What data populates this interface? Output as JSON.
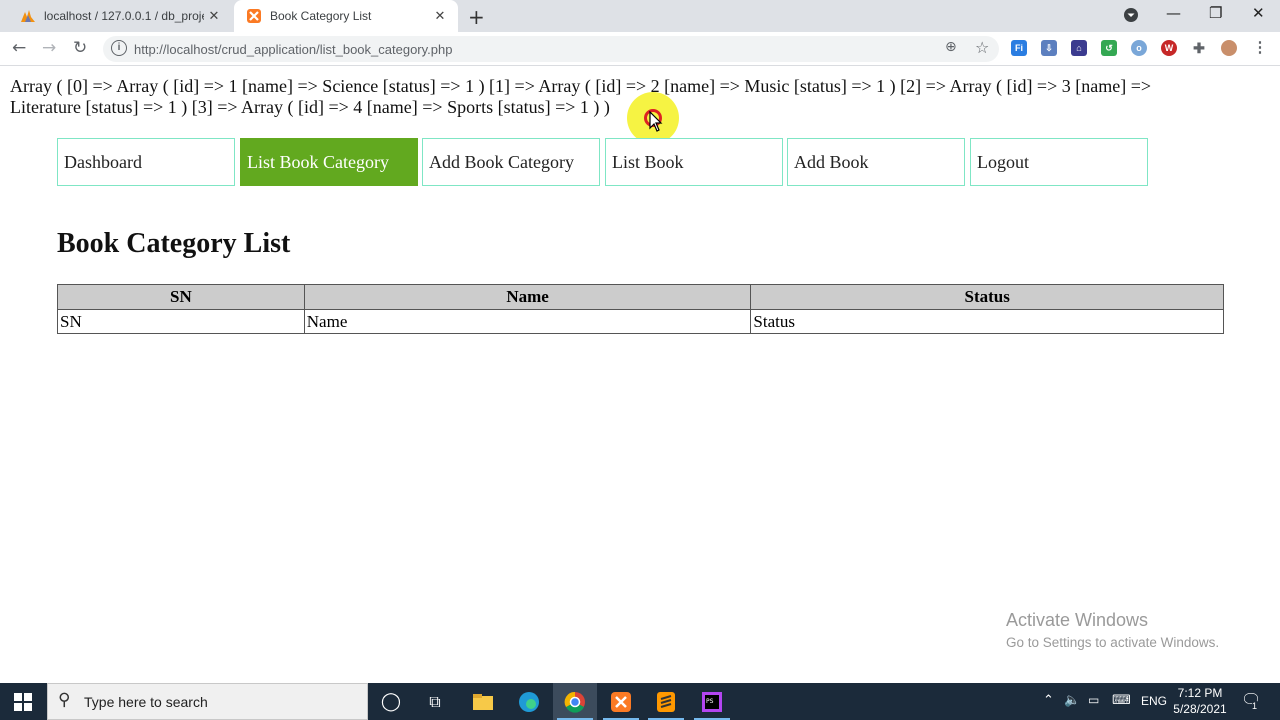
{
  "browser": {
    "tabs": [
      {
        "title": "localhost / 127.0.0.1 / db_project",
        "active": false
      },
      {
        "title": "Book Category List",
        "active": true
      }
    ],
    "url": "http://localhost/crud_application/list_book_category.php"
  },
  "page": {
    "print_r_line1": "Array ( [0] => Array ( [id] => 1 [name] => Science [status] => 1 ) [1] => Array ( [id] => 2 [name] => Music [status] => 1 ) [2] => Array ( [id] => 3 [name] =>",
    "print_r_line2": "Literature [status] => 1 ) [3] => Array ( [id] => 4 [name] => Sports [status] => 1 ) )",
    "menu": [
      {
        "label": "Dashboard",
        "active": false
      },
      {
        "label": "List Book Category",
        "active": true
      },
      {
        "label": "Add Book Category",
        "active": false
      },
      {
        "label": "List Book",
        "active": false
      },
      {
        "label": "Add Book",
        "active": false
      },
      {
        "label": "Logout",
        "active": false
      }
    ],
    "heading": "Book Category List",
    "table": {
      "headers": [
        "SN",
        "Name",
        "Status"
      ],
      "rows": [
        [
          "SN",
          "Name",
          "Status"
        ]
      ]
    },
    "watermark": {
      "line1": "Activate Windows",
      "line2": "Go to Settings to activate Windows."
    }
  },
  "taskbar": {
    "search_placeholder": "Type here to search",
    "language": "ENG",
    "time": "7:12 PM",
    "date": "5/28/2021",
    "notification_count": "1"
  },
  "colors": {
    "active_menu": "#62a91f",
    "menu_border": "#7fe6c5",
    "table_header_bg": "#cccccc",
    "taskbar_bg": "#1b2a3a"
  }
}
